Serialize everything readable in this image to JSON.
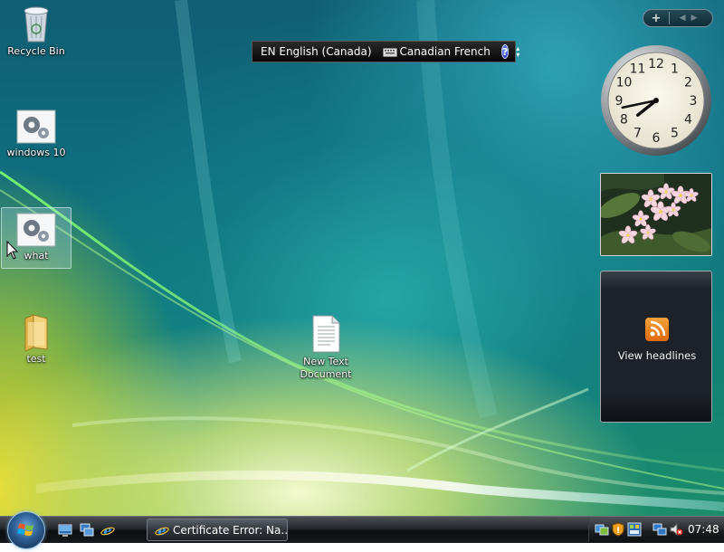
{
  "desktop": {
    "icons": [
      {
        "label": "Recycle Bin"
      },
      {
        "label": "windows 10"
      },
      {
        "label": "what"
      },
      {
        "label": "test"
      },
      {
        "label": "New Text Document"
      }
    ]
  },
  "language_bar": {
    "language": "EN English (Canada)",
    "keyboard": "Canadian French",
    "help": "?"
  },
  "sidebar": {
    "add_label": "+",
    "feed_headlines_label": "View headlines",
    "clock": {
      "hour": 7,
      "minute": 43
    }
  },
  "taskbar": {
    "task_button_label": "Certificate Error: Na...",
    "clock": "07:48"
  },
  "colors": {
    "start_orb": "#2d5f95",
    "rss_orange": "#f29a30"
  }
}
